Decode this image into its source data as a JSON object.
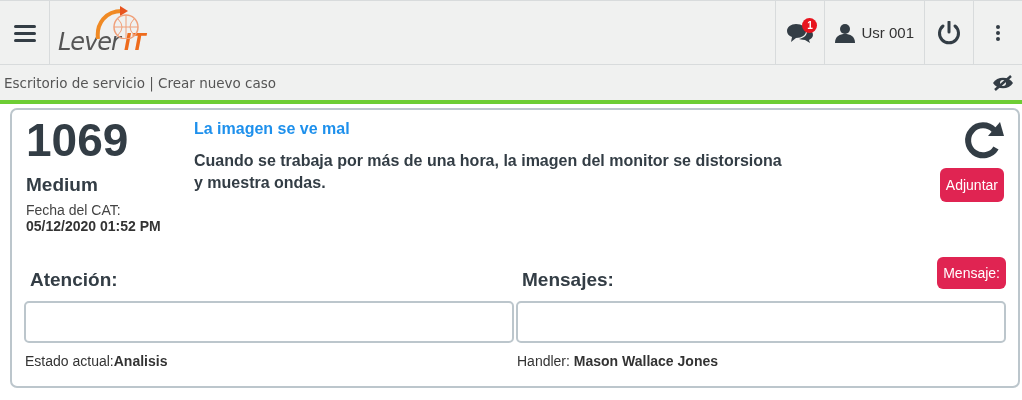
{
  "header": {
    "logo": {
      "word": "Lever",
      "suffix": "IT"
    },
    "notifications": {
      "badge": "1"
    },
    "user": "Usr 001"
  },
  "breadcrumb": "Escritorio de servicio | Crear nuevo caso",
  "case": {
    "number": "1069",
    "priority": "Medium",
    "date_label": "Fecha del CAT:",
    "date": "05/12/2020 01:52 PM",
    "title": "La imagen se ve mal",
    "description": "Cuando se trabaja por más de una hora, la imagen del monitor se distorsiona y muestra ondas.",
    "attach_button": "Adjuntar"
  },
  "panels": [
    {
      "heading": "Atención:",
      "footer": "Estado actual:**Analisis**"
    },
    {
      "heading": "Mensajes:",
      "button": "Mensaje:",
      "footer": "Handler: **Mason Wallace Jones**"
    }
  ]
}
